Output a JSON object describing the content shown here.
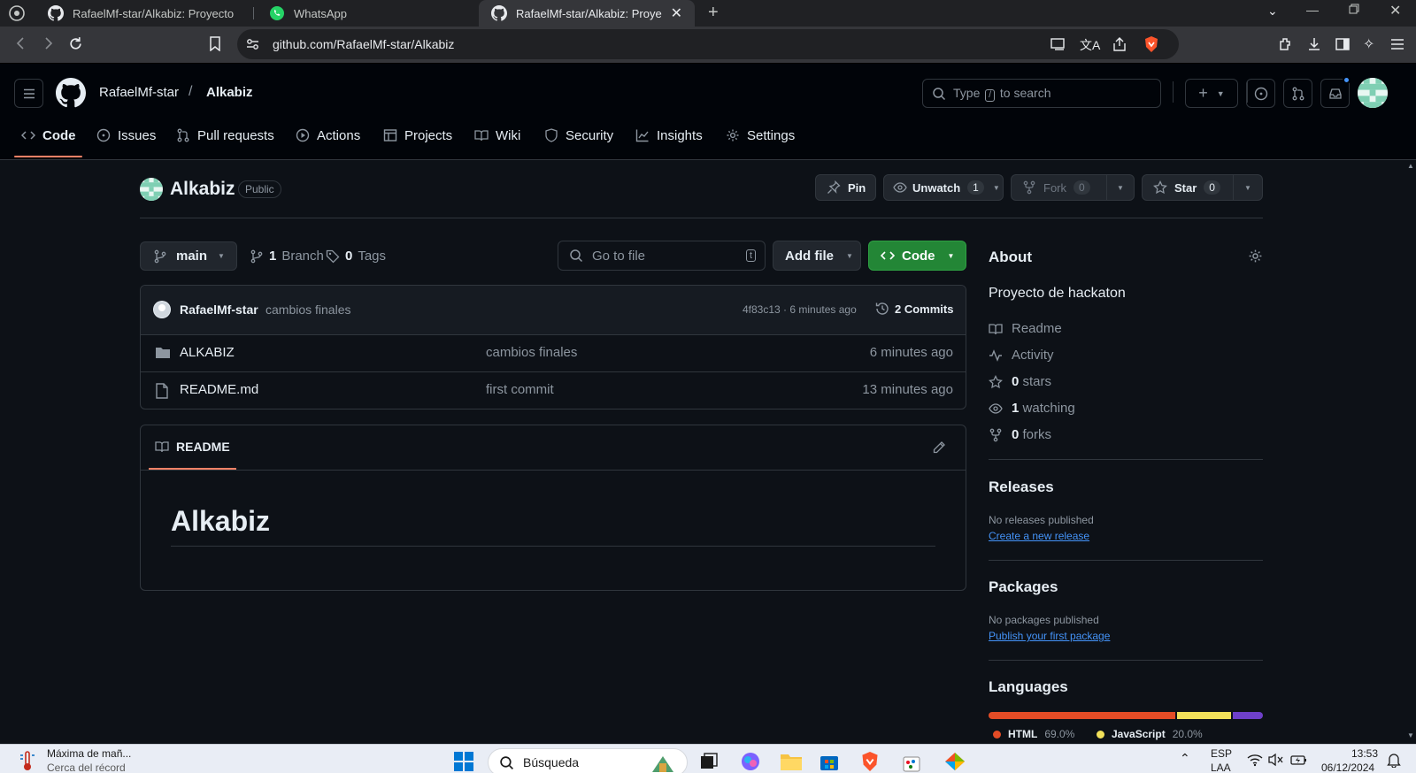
{
  "browser": {
    "tabs": [
      {
        "title": "RafaelMf-star/Alkabiz: Proyecto de h",
        "active": false
      },
      {
        "title": "WhatsApp",
        "active": false
      },
      {
        "title": "RafaelMf-star/Alkabiz: Proyecto",
        "active": true
      }
    ],
    "new_tab": "+",
    "url": "github.com/RafaelMf-star/Alkabiz"
  },
  "header": {
    "owner": "RafaelMf-star",
    "separator": "/",
    "repo": "Alkabiz",
    "search_prefix": "Type",
    "search_key": "/",
    "search_suffix": "to search"
  },
  "repo_nav": [
    {
      "label": "Code",
      "icon": "code-icon"
    },
    {
      "label": "Issues",
      "icon": "issue-icon"
    },
    {
      "label": "Pull requests",
      "icon": "pull-request-icon"
    },
    {
      "label": "Actions",
      "icon": "play-icon"
    },
    {
      "label": "Projects",
      "icon": "table-icon"
    },
    {
      "label": "Wiki",
      "icon": "book-icon"
    },
    {
      "label": "Security",
      "icon": "shield-icon"
    },
    {
      "label": "Insights",
      "icon": "graph-icon"
    },
    {
      "label": "Settings",
      "icon": "gear-icon"
    }
  ],
  "repo_head": {
    "name": "Alkabiz",
    "visibility": "Public",
    "pin": "Pin",
    "unwatch": "Unwatch",
    "watch_count": "1",
    "fork": "Fork",
    "fork_count": "0",
    "star": "Star",
    "star_count": "0"
  },
  "file_nav": {
    "branch": "main",
    "branch_count": "1",
    "branch_label": "Branch",
    "tag_count": "0",
    "tag_label": "Tags",
    "go_to_file_placeholder": "Go to file",
    "go_to_file_key": "t",
    "add_file": "Add file",
    "code": "Code"
  },
  "latest_commit": {
    "author": "RafaelMf-star",
    "message": "cambios finales",
    "meta": "4f83c13 · 6 minutes ago",
    "commits": "2 Commits"
  },
  "files": [
    {
      "type": "folder",
      "name": "ALKABIZ",
      "message": "cambios finales",
      "date": "6 minutes ago"
    },
    {
      "type": "file",
      "name": "README.md",
      "message": "first commit",
      "date": "13 minutes ago"
    }
  ],
  "readme": {
    "tab": "README",
    "heading": "Alkabiz"
  },
  "about": {
    "title": "About",
    "description": "Proyecto de hackaton",
    "readme": "Readme",
    "activity": "Activity",
    "stars_count": "0",
    "stars_label": "stars",
    "watching_count": "1",
    "watching_label": "watching",
    "forks_count": "0",
    "forks_label": "forks"
  },
  "releases": {
    "title": "Releases",
    "none": "No releases published",
    "link": "Create a new release"
  },
  "packages": {
    "title": "Packages",
    "none": "No packages published",
    "link": "Publish your first package"
  },
  "languages": {
    "title": "Languages",
    "items": [
      {
        "name": "HTML",
        "percent": 69.0,
        "label": "69.0%",
        "color": "#e34c26"
      },
      {
        "name": "JavaScript",
        "percent": 20.0,
        "label": "20.0%",
        "color": "#f1e05a"
      },
      {
        "name": "",
        "percent": 11.0,
        "label": "",
        "color": "#6e40c9"
      }
    ]
  },
  "taskbar": {
    "weather_title": "Máxima de mañ...",
    "weather_sub": "Cerca del récord",
    "search": "Búsqueda",
    "lang": "ESP",
    "lang_sub": "LAA",
    "time": "13:53",
    "date": "06/12/2024"
  },
  "colors": {
    "background": "#0d1117",
    "header": "#010409",
    "border": "#30363d",
    "accent_green": "#238636",
    "link": "#4493f8",
    "nav_underline": "#f78166"
  }
}
